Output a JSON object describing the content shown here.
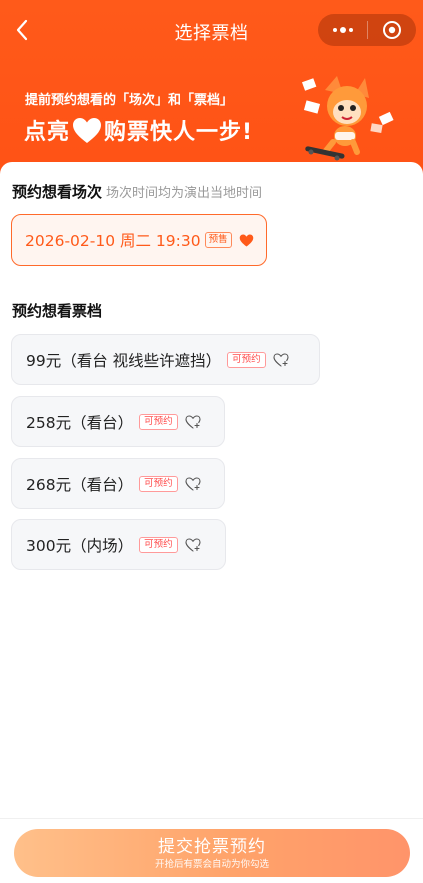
{
  "nav": {
    "title": "选择票档",
    "back_icon": "chevron-left-icon",
    "menu_icon": "more-dots-icon",
    "close_icon": "target-circle-icon"
  },
  "banner": {
    "subtitle": "提前预约想看的「场次」和「票档」",
    "title_left": "点亮",
    "title_right": "购票快人一步!",
    "heart_icon": "heart-icon"
  },
  "session_section": {
    "title": "预约想看场次",
    "hint": "场次时间均为演出当地时间",
    "selected": {
      "datetime": "2026-02-10 周二 19:30",
      "tag": "预售",
      "icon": "heart-filled-icon"
    }
  },
  "ticket_section": {
    "title": "预约想看票档",
    "tiers": [
      {
        "label": "99元（看台 视线些许遮挡）",
        "tag": "可预约"
      },
      {
        "label": "258元（看台）",
        "tag": "可预约"
      },
      {
        "label": "268元（看台）",
        "tag": "可预约"
      },
      {
        "label": "300元（内场）",
        "tag": "可预约"
      }
    ]
  },
  "footer": {
    "button_label": "提交抢票预约",
    "button_sub": "开抢后有票会自动为你勾选"
  },
  "colors": {
    "brand": "#ff5a1a",
    "tag_red": "#ff4d4d",
    "button_start": "#ffc08a",
    "button_end": "#ff946a"
  }
}
